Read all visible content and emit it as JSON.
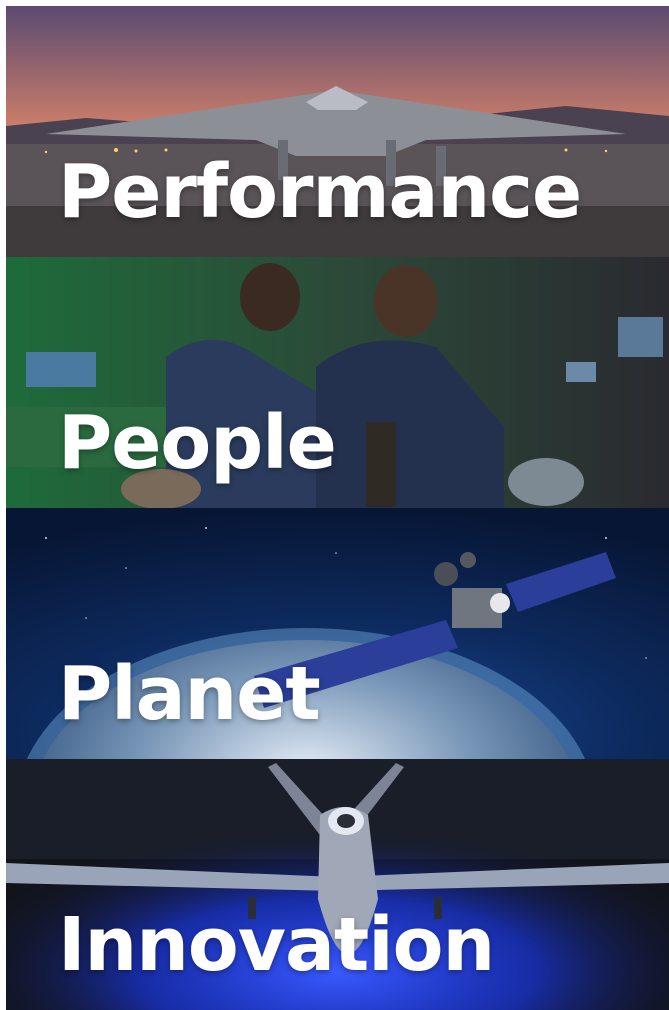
{
  "panels": [
    {
      "id": "performance",
      "label": "Performance",
      "scene": "stealth-drone-on-runway-at-sunset"
    },
    {
      "id": "people",
      "label": "People",
      "scene": "engineers-in-lab-with-equipment"
    },
    {
      "id": "planet",
      "label": "Planet",
      "scene": "satellite-over-earth"
    },
    {
      "id": "innovation",
      "label": "Innovation",
      "scene": "drone-in-hangar"
    }
  ],
  "colors": {
    "label_text": "#ffffff",
    "sunset_top": "#5b4a72",
    "sunset_mid": "#e58a5c",
    "lab_green": "#1e6b3a",
    "space_blue": "#0a1e4a",
    "hangar_blue": "#1b3cff"
  }
}
